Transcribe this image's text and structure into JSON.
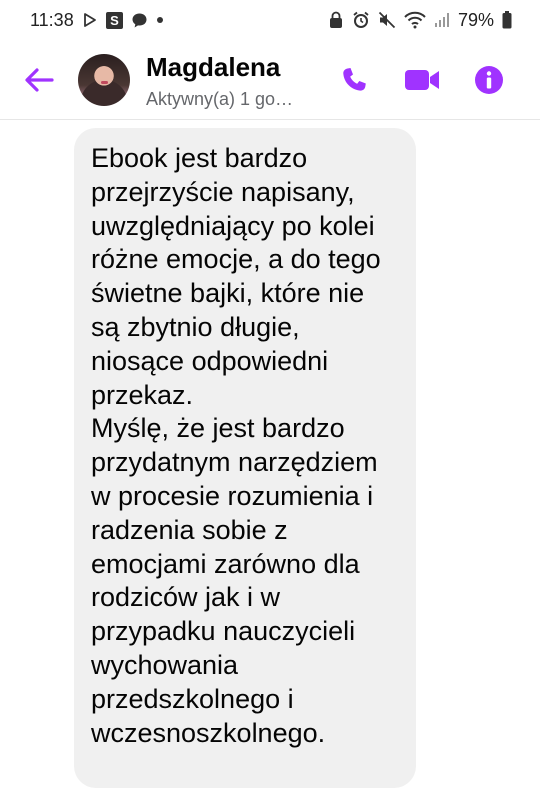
{
  "status_bar": {
    "time": "11:38",
    "battery": "79%",
    "icons": [
      "play-store-icon",
      "s-app-icon",
      "chat-bubble-icon",
      "dot-icon",
      "lock-icon",
      "alarm-icon",
      "mute-icon",
      "wifi-icon",
      "signal-icon",
      "battery-icon"
    ]
  },
  "header": {
    "name": "Magdalena",
    "status": "Aktywny(a) 1 go…",
    "accent_color": "#a033ff",
    "icons": [
      "back-arrow-icon",
      "phone-icon",
      "video-camera-icon",
      "info-icon"
    ]
  },
  "message": {
    "lines": [
      "Ebook jest bardzo",
      "przejrzyście napisany,",
      "uwzględniający po kolei",
      "różne emocje, a do tego",
      "świetne bajki, które nie",
      "są zbytnio długie,",
      "niosące odpowiedni",
      "przekaz.",
      "Myślę, że jest bardzo",
      "przydatnym narzędziem",
      "w procesie rozumienia i",
      "radzenia sobie z",
      "emocjami zarówno dla",
      "rodziców jak i w",
      "przypadku nauczycieli",
      "wychowania",
      "przedszkolnego i",
      "wczesnoszkolnego."
    ],
    "bubble_color": "#f0f0f0"
  }
}
